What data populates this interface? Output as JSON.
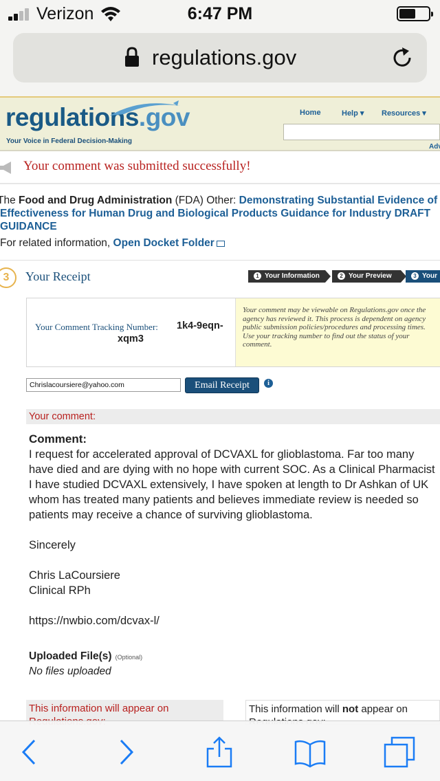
{
  "status_bar": {
    "carrier": "Verizon",
    "time": "6:47 PM"
  },
  "browser": {
    "url": "regulations.gov"
  },
  "site": {
    "logo_main": "regulations",
    "logo_tld": ".gov",
    "tagline": "Your Voice in Federal Decision-Making",
    "nav": {
      "home": "Home",
      "help": "Help ▾",
      "resources": "Resources ▾"
    },
    "advanced": "Adv"
  },
  "success_message": "Your comment was submitted successfully!",
  "docket": {
    "prefix": "The ",
    "agency": "Food and Drug Administration",
    "agency_abbr": " (FDA) Other: ",
    "title": "Demonstrating Substantial Evidence of Effectiveness for Human Drug and Biological Products Guidance for Industry DRAFT GUIDANCE",
    "related_prefix": "For related information, ",
    "related_link": "Open Docket Folder"
  },
  "receipt": {
    "step_number": "3",
    "title": "Your Receipt",
    "steps": [
      {
        "num": "1",
        "label": "Your Information"
      },
      {
        "num": "2",
        "label": "Your Preview"
      },
      {
        "num": "3",
        "label": "Your"
      }
    ],
    "tracking_label": "Your Comment Tracking Number:",
    "tracking_number_1": "1k4-9eqn-",
    "tracking_number_2": "xqm3",
    "tracking_note": "Your comment may be viewable on Regulations.gov once the agency has reviewed it. This process is dependent on agency public submission policies/procedures and processing times. Use your tracking number to find out the status of your comment.",
    "email_value": "Chrislacoursiere@yahoo.com",
    "email_button": "Email Receipt",
    "info_icon": "i"
  },
  "comment": {
    "section_label": "Your comment:",
    "label": "Comment:",
    "text": "I request for accelerated approval of DCVAXL for glioblastoma. Far too many have died and are dying with no hope with current SOC. As a Clinical Pharmacist I have studied DCVAXL extensively, I have spoken at length to Dr Ashkan of UK whom has treated many patients and believes immediate review is needed so patients may receive a chance of surviving glioblastoma.\n\nSincerely\n\nChris LaCoursiere\nClinical RPh\n\nhttps://nwbio.com/dcvax-l/",
    "uploaded_label": "Uploaded File(s)",
    "optional": "(Optional)",
    "no_files": "No files uploaded"
  },
  "info_boxes": {
    "appear": "This information will appear on Regulations.gov:",
    "not_appear_pre": "This information will ",
    "not_appear_bold": "not",
    "not_appear_post": " appear on Regulations.gov:"
  },
  "toolbar_icons": [
    "back-icon",
    "forward-icon",
    "share-icon",
    "bookmarks-icon",
    "tabs-icon"
  ]
}
